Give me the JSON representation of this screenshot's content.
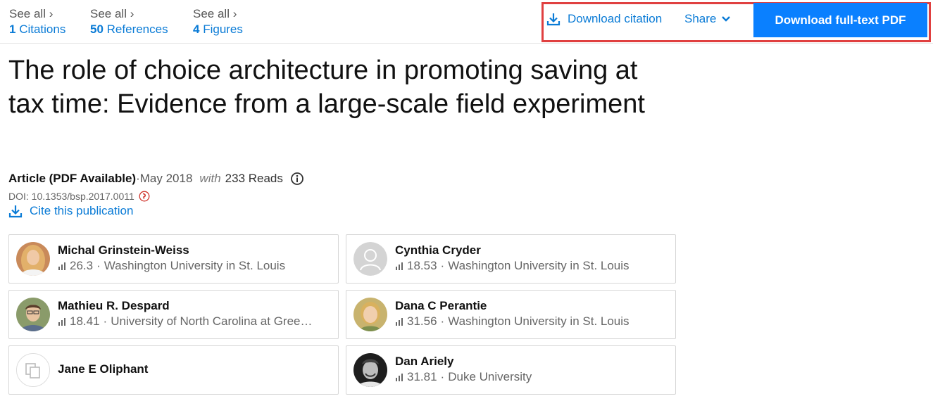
{
  "stats": [
    {
      "see": "See all ›",
      "count": "1",
      "label": "Citations"
    },
    {
      "see": "See all ›",
      "count": "50",
      "label": "References"
    },
    {
      "see": "See all ›",
      "count": "4",
      "label": "Figures"
    }
  ],
  "actions": {
    "download_citation": "Download citation",
    "share": "Share",
    "download_pdf": "Download full-text PDF"
  },
  "title": "The role of choice architecture in promoting saving at tax time: Evidence from a large-scale field experiment",
  "meta": {
    "type": "Article (PDF Available)",
    "sep": " · ",
    "date": "May 2018",
    "with": "with",
    "reads": "233 Reads"
  },
  "doi": "DOI: 10.1353/bsp.2017.0011",
  "cite_label": "Cite this publication",
  "authors": [
    {
      "name": "Michal Grinstein-Weiss",
      "score": "26.3",
      "affiliation": "Washington University in St. Louis"
    },
    {
      "name": "Cynthia Cryder",
      "score": "18.53",
      "affiliation": "Washington University in St. Louis"
    },
    {
      "name": "Mathieu R. Despard",
      "score": "18.41",
      "affiliation": "University of North Carolina at Gree…"
    },
    {
      "name": "Dana C Perantie",
      "score": "31.56",
      "affiliation": "Washington University in St. Louis"
    },
    {
      "name": "Jane E Oliphant",
      "score": "",
      "affiliation": ""
    },
    {
      "name": "Dan Ariely",
      "score": "31.81",
      "affiliation": "Duke University"
    }
  ],
  "colors": {
    "link": "#0a7bd6",
    "primary_button": "#0a80ff",
    "highlight": "#e04040"
  }
}
